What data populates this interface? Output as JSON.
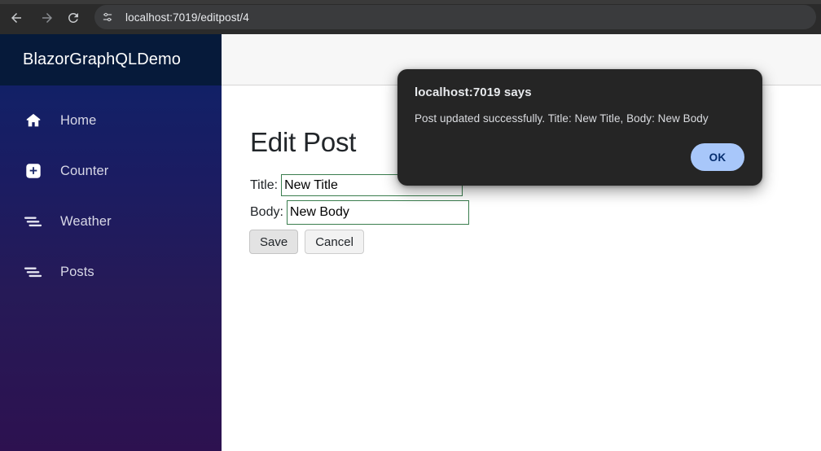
{
  "browser": {
    "back_icon": "arrow-left-icon",
    "forward_icon": "arrow-right-icon",
    "reload_icon": "reload-icon",
    "site_settings_icon": "tune-sliders-icon",
    "url": "localhost:7019/editpost/4"
  },
  "sidebar": {
    "brand": "BlazorGraphQLDemo",
    "items": [
      {
        "label": "Home",
        "icon": "home-icon"
      },
      {
        "label": "Counter",
        "icon": "plus-square-icon"
      },
      {
        "label": "Weather",
        "icon": "list-icon"
      },
      {
        "label": "Posts",
        "icon": "list-icon"
      }
    ],
    "gradient_start": "#0d2369",
    "gradient_end": "#2d1150",
    "brand_bg": "#061a3a"
  },
  "main": {
    "page_title": "Edit Post",
    "form": {
      "title_label": "Title:",
      "title_value": "New Title",
      "body_label": "Body:",
      "body_value": "New Body",
      "save_label": "Save",
      "cancel_label": "Cancel",
      "input_border_color": "#3a7d4e"
    }
  },
  "dialog": {
    "title": "localhost:7019 says",
    "message": "Post updated successfully. Title: New Title, Body: New Body",
    "ok_label": "OK",
    "ok_bg": "#a8c7fa",
    "bg": "#252525"
  }
}
